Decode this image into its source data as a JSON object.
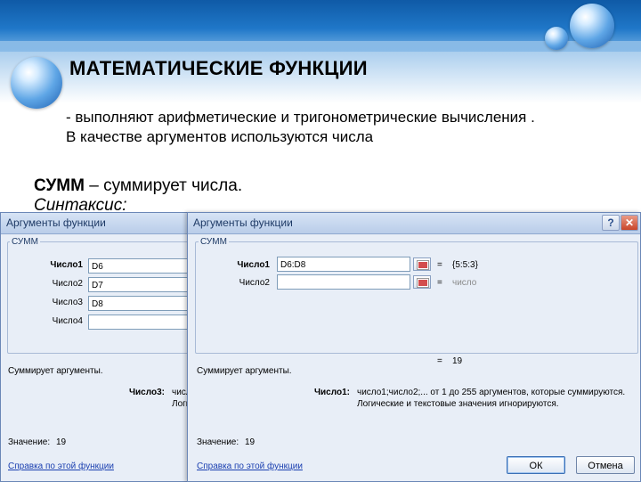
{
  "slide": {
    "title": "МАТЕМАТИЧЕСКИЕ ФУНКЦИИ",
    "desc_line1": "- выполняют арифметические и тригонометрические вычисления .",
    "desc_line2": "В качестве аргументов используются числа",
    "summ_name": "СУММ",
    "summ_desc": " – суммирует числа.",
    "syntax": "Синтаксис:"
  },
  "dialog_left": {
    "title": "Аргументы функции",
    "func_name": "СУММ",
    "args": [
      {
        "label": "Число1",
        "value": "D6"
      },
      {
        "label": "Число2",
        "value": "D7"
      },
      {
        "label": "Число3",
        "value": "D8"
      },
      {
        "label": "Число4",
        "value": ""
      }
    ],
    "description": "Суммирует аргументы.",
    "arg_help_label": "Число3:",
    "arg_help_text_1": "числ",
    "arg_help_text_2": "Логи",
    "result_label": "Значение:",
    "result_value": "19",
    "help_link": "Справка по этой функции"
  },
  "dialog_right": {
    "title": "Аргументы функции",
    "help_glyph": "?",
    "close_glyph": "✕",
    "func_name": "СУММ",
    "args": [
      {
        "label": "Число1",
        "value": "D6:D8",
        "equals": "=",
        "result": "{5:5:3}"
      },
      {
        "label": "Число2",
        "value": "",
        "equals": "=",
        "result": "число"
      }
    ],
    "total_equals": "=",
    "total_value": "19",
    "description": "Суммирует аргументы.",
    "arg_help_label": "Число1:",
    "arg_help_text_1": "число1;число2;... от 1 до 255 аргументов, которые суммируются.",
    "arg_help_text_2": "Логические и текстовые значения игнорируются.",
    "result_label": "Значение:",
    "result_value": "19",
    "help_link": "Справка по этой функции",
    "ok_label": "ОК",
    "cancel_label": "Отмена"
  }
}
